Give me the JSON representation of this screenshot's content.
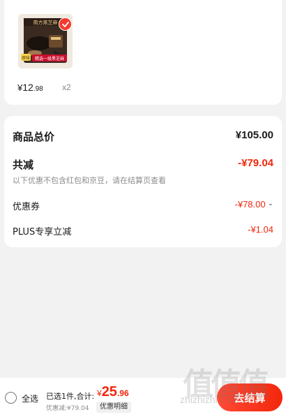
{
  "product": {
    "currency": "¥",
    "price_int": "12",
    "price_dec": ".98",
    "quantity": "x2",
    "thumb_brand": "南方黑芝麻",
    "thumb_tag": "原味",
    "thumb_banner": "精选一级黑芝麻"
  },
  "summary": {
    "total_label": "商品总价",
    "total_value": "¥105.00",
    "reduce_label": "共减",
    "reduce_value": "-¥79.04",
    "note": "以下优惠不包含红包和京豆，请在结算页查看",
    "coupon_label": "优惠券",
    "coupon_value": "-¥78.00",
    "plus_label": "PLUS专享立减",
    "plus_value": "-¥1.04"
  },
  "bottom_bar": {
    "select_all": "全选",
    "selected_info": "已选1件,合计:",
    "total_currency": "¥",
    "total_int": "25",
    "total_dec": ".96",
    "discount_line": "优惠减:¥79.04",
    "detail_button": "优惠明细",
    "checkout_button": "去结算"
  },
  "watermark": {
    "logo": "值值值",
    "url": "zhizhizhi.com"
  },
  "colors": {
    "accent": "#f2270c",
    "background": "#f2f2f2",
    "muted_text": "#8c8c8c"
  }
}
